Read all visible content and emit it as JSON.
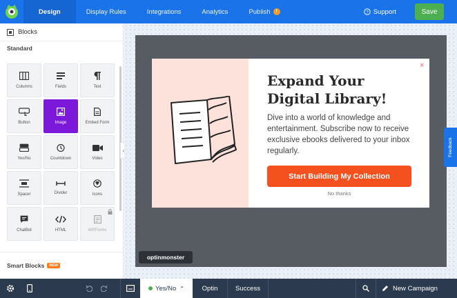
{
  "topbar": {
    "tabs": [
      {
        "label": "Design",
        "active": true
      },
      {
        "label": "Display Rules"
      },
      {
        "label": "Integrations"
      },
      {
        "label": "Analytics"
      },
      {
        "label": "Publish"
      }
    ],
    "support_label": "Support",
    "save_label": "Save",
    "accent_color": "#1a73e8"
  },
  "sidebar": {
    "header": "Blocks",
    "section": "Standard",
    "blocks": [
      {
        "label": "Columns",
        "icon": "columns-icon"
      },
      {
        "label": "Fields",
        "icon": "fields-icon"
      },
      {
        "label": "Text",
        "icon": "paragraph-icon"
      },
      {
        "label": "Button",
        "icon": "button-icon"
      },
      {
        "label": "Image",
        "icon": "image-icon",
        "active": true
      },
      {
        "label": "Embed Form",
        "icon": "embed-form-icon"
      },
      {
        "label": "Yes/No",
        "icon": "yes-no-icon"
      },
      {
        "label": "Countdown",
        "icon": "countdown-icon"
      },
      {
        "label": "Video",
        "icon": "video-icon"
      },
      {
        "label": "Spacer",
        "icon": "spacer-icon"
      },
      {
        "label": "Divider",
        "icon": "divider-icon"
      },
      {
        "label": "Icons",
        "icon": "icons-icon"
      },
      {
        "label": "ChatBot",
        "icon": "chatbot-icon"
      },
      {
        "label": "HTML",
        "icon": "html-icon"
      },
      {
        "label": "WPForms",
        "icon": "wpforms-icon",
        "locked": true
      }
    ],
    "smart_blocks": "Smart Blocks",
    "new_badge": "NEW"
  },
  "popup": {
    "headline_line1": "Expand Your",
    "headline_line2": "Digital Library!",
    "body": "Dive into a world of knowledge and entertainment. Subscribe now to receive exclusive ebooks delivered to your inbox regularly.",
    "cta": "Start Building My Collection",
    "no_thanks": "No thanks",
    "cta_color": "#f4511e",
    "left_panel_color": "#fde2db"
  },
  "brand_badge": "optinmonster",
  "feedback_label": "Feedback",
  "bottombar": {
    "view_tabs": [
      {
        "label": "Yes/No",
        "active": true
      },
      {
        "label": "Optin"
      },
      {
        "label": "Success"
      }
    ],
    "campaign_label": "New Campaign"
  }
}
